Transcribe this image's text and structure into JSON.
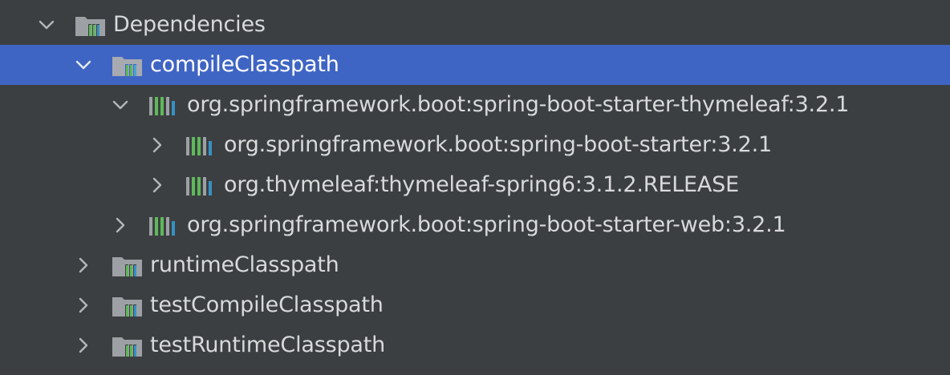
{
  "tree": {
    "root": {
      "label": "Dependencies",
      "expanded": true,
      "icon": "folder-library-icon"
    },
    "configurations": [
      {
        "label": "compileClasspath",
        "expanded": true,
        "selected": true,
        "icon": "folder-library-icon",
        "children": [
          {
            "label": "org.springframework.boot:spring-boot-starter-thymeleaf:3.2.1",
            "expanded": true,
            "icon": "library-icon",
            "children": [
              {
                "label": "org.springframework.boot:spring-boot-starter:3.2.1",
                "expanded": false,
                "icon": "library-icon"
              },
              {
                "label": "org.thymeleaf:thymeleaf-spring6:3.1.2.RELEASE",
                "expanded": false,
                "icon": "library-icon"
              }
            ]
          },
          {
            "label": "org.springframework.boot:spring-boot-starter-web:3.2.1",
            "expanded": false,
            "icon": "library-icon"
          }
        ]
      },
      {
        "label": "runtimeClasspath",
        "expanded": false,
        "icon": "folder-library-icon"
      },
      {
        "label": "testCompileClasspath",
        "expanded": false,
        "icon": "folder-library-icon"
      },
      {
        "label": "testRuntimeClasspath",
        "expanded": false,
        "icon": "folder-library-icon"
      }
    ]
  },
  "colors": {
    "background": "#3c3f41",
    "selection": "#3f65c4",
    "text": "#d7d9db",
    "icon_gray": "#9da0a4",
    "icon_green": "#5fb85a",
    "icon_blue": "#3592c4"
  }
}
